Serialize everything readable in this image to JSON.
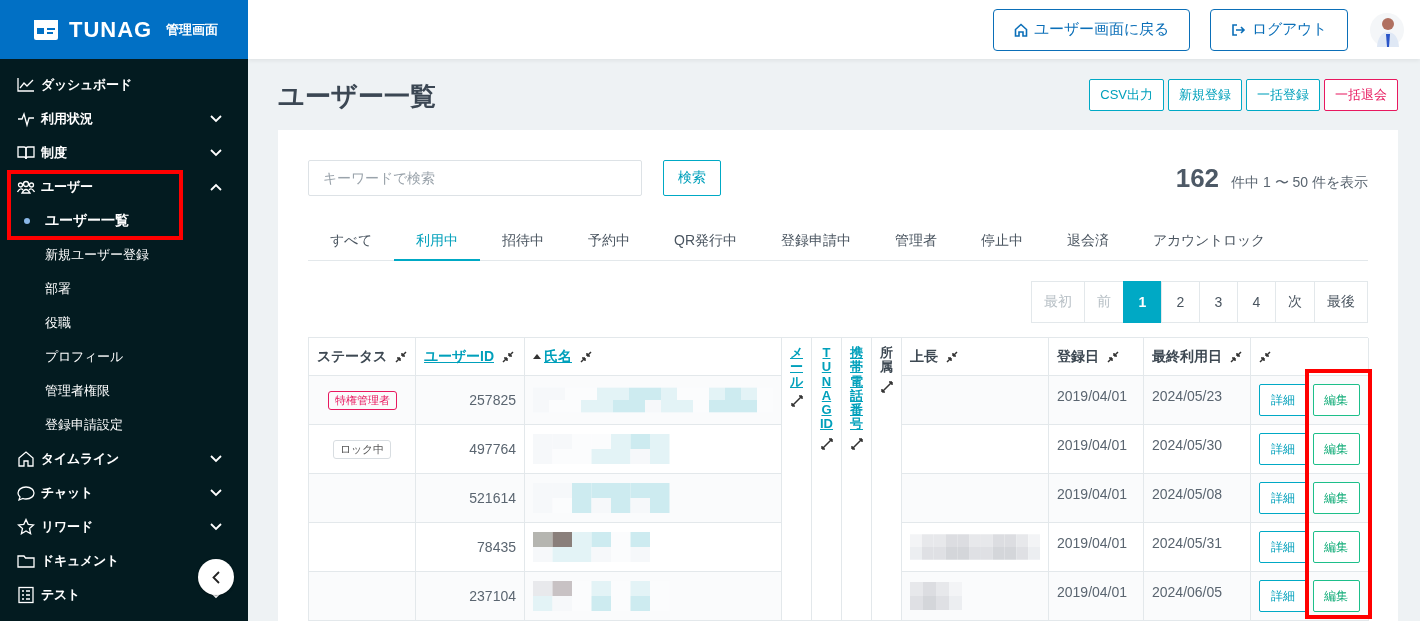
{
  "logo": {
    "brand": "TUNAG",
    "subtitle": "管理画面"
  },
  "sidebar": {
    "items": [
      {
        "label": "ダッシュボード"
      },
      {
        "label": "利用状況",
        "expanded": false
      },
      {
        "label": "制度",
        "expanded": false
      },
      {
        "label": "ユーザー",
        "expanded": true,
        "highlighted": true,
        "children": [
          {
            "label": "ユーザー一覧",
            "selected": true
          },
          {
            "label": "新規ユーザー登録",
            "selected": false
          },
          {
            "label": "部署",
            "selected": false
          },
          {
            "label": "役職",
            "selected": false
          },
          {
            "label": "プロフィール",
            "selected": false
          },
          {
            "label": "管理者権限",
            "selected": false
          },
          {
            "label": "登録申請設定",
            "selected": false
          }
        ]
      },
      {
        "label": "タイムライン",
        "expanded": false
      },
      {
        "label": "チャット",
        "expanded": false
      },
      {
        "label": "リワード",
        "expanded": false
      },
      {
        "label": "ドキュメント"
      },
      {
        "label": "テスト",
        "expanded": false
      }
    ]
  },
  "header": {
    "buttons": [
      {
        "label": "ユーザー画面に戻る"
      },
      {
        "label": "ログアウト"
      }
    ]
  },
  "page": {
    "title": "ユーザー一覧",
    "actions": [
      {
        "label": "CSV出力",
        "kind": "normal"
      },
      {
        "label": "新規登録",
        "kind": "normal"
      },
      {
        "label": "一括登録",
        "kind": "normal"
      },
      {
        "label": "一括退会",
        "kind": "danger"
      }
    ]
  },
  "search": {
    "placeholder": "キーワードで検索",
    "button": "検索"
  },
  "result_count": {
    "total": "162",
    "range": "件中 1 〜 50 件を表示"
  },
  "tabs": [
    {
      "label": "すべて",
      "selected": false
    },
    {
      "label": "利用中",
      "selected": true
    },
    {
      "label": "招待中",
      "selected": false
    },
    {
      "label": "予約中",
      "selected": false
    },
    {
      "label": "QR発行中",
      "selected": false
    },
    {
      "label": "登録申請中",
      "selected": false
    },
    {
      "label": "管理者",
      "selected": false
    },
    {
      "label": "停止中",
      "selected": false
    },
    {
      "label": "退会済",
      "selected": false
    },
    {
      "label": "アカウントロック",
      "selected": false
    }
  ],
  "pagination": [
    {
      "label": "最初",
      "selected": false,
      "disabled": true
    },
    {
      "label": "前",
      "selected": false,
      "disabled": true
    },
    {
      "label": "1",
      "selected": true,
      "disabled": false
    },
    {
      "label": "2",
      "selected": false,
      "disabled": false
    },
    {
      "label": "3",
      "selected": false,
      "disabled": false
    },
    {
      "label": "4",
      "selected": false,
      "disabled": false
    },
    {
      "label": "次",
      "selected": false,
      "disabled": false
    },
    {
      "label": "最後",
      "selected": false,
      "disabled": false
    }
  ],
  "table": {
    "edit_highlighted": true,
    "columns": [
      {
        "label": "ステータス",
        "sortable": false,
        "sorted": false,
        "collapsed": false
      },
      {
        "label": "ユーザーID",
        "sortable": true,
        "sorted": false,
        "collapsed": false
      },
      {
        "label": "氏名",
        "sortable": true,
        "sorted": true,
        "collapsed": false
      },
      {
        "label": "メール",
        "sortable": true,
        "sorted": false,
        "collapsed": true
      },
      {
        "label": "TUNAG ID",
        "sortable": true,
        "sorted": false,
        "collapsed": true
      },
      {
        "label": "携帯電話番号",
        "sortable": true,
        "sorted": false,
        "collapsed": true
      },
      {
        "label": "所属",
        "sortable": false,
        "sorted": false,
        "collapsed": true
      },
      {
        "label": "上長",
        "sortable": false,
        "sorted": false,
        "collapsed": false
      },
      {
        "label": "登録日",
        "sortable": false,
        "sorted": false,
        "collapsed": false
      },
      {
        "label": "最終利用日",
        "sortable": false,
        "sorted": false,
        "collapsed": false
      },
      {
        "collapsed": false
      }
    ],
    "rows": [
      {
        "status": {
          "label": "特権管理者",
          "kind": "privileged"
        },
        "user_id": "257825",
        "boss_redacted": false,
        "registered": "2019/04/01",
        "last_used": "2024/05/23",
        "details_button": "詳細",
        "edit_button": "編集"
      },
      {
        "status": {
          "label": "ロック中",
          "kind": "locked"
        },
        "user_id": "497764",
        "boss_redacted": false,
        "registered": "2019/04/01",
        "last_used": "2024/05/30",
        "details_button": "詳細",
        "edit_button": "編集"
      },
      {
        "user_id": "521614",
        "boss_redacted": false,
        "registered": "2019/04/01",
        "last_used": "2024/05/08",
        "details_button": "詳細",
        "edit_button": "編集"
      },
      {
        "user_id": "78435",
        "boss_redacted": true,
        "registered": "2019/04/01",
        "last_used": "2024/05/31",
        "details_button": "詳細",
        "edit_button": "編集"
      },
      {
        "user_id": "237104",
        "boss_redacted": true,
        "registered": "2019/04/01",
        "last_used": "2024/06/05",
        "details_button": "詳細",
        "edit_button": "編集"
      }
    ]
  }
}
